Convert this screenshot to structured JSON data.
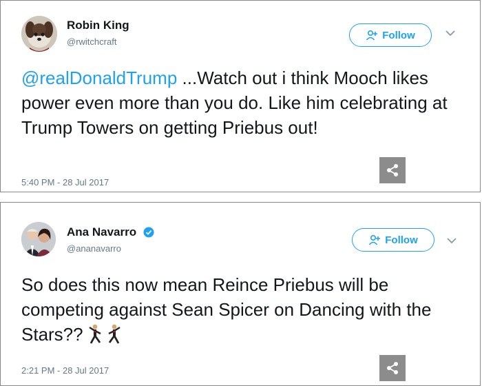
{
  "colors": {
    "accent": "#1da1f2",
    "text": "#14171a",
    "muted": "#657786",
    "share_bg": "#8c8c8c"
  },
  "tweets": [
    {
      "display_name": "Robin King",
      "handle": "@rwitchcraft",
      "verified": false,
      "follow_label": "Follow",
      "mention": "@realDonaldTrump",
      "text": " ...Watch out i think Mooch likes power even more than you do. Like him celebrating at Trump Towers on getting Priebus out!",
      "timestamp": "5:40 PM - 28 Jul 2017",
      "icons": [
        "avatar",
        "follow-person-icon",
        "chevron-down-icon",
        "share-icon"
      ]
    },
    {
      "display_name": "Ana Navarro",
      "handle": "@ananavarro",
      "verified": true,
      "follow_label": "Follow",
      "text": "So does this now mean Reince Priebus will be competing against Sean Spicer on Dancing with the Stars??",
      "emoji": [
        "dancer-emoji",
        "dancer-emoji"
      ],
      "timestamp": "2:21 PM - 28 Jul 2017",
      "icons": [
        "avatar",
        "verified-badge-icon",
        "follow-person-icon",
        "chevron-down-icon",
        "share-icon"
      ]
    }
  ]
}
